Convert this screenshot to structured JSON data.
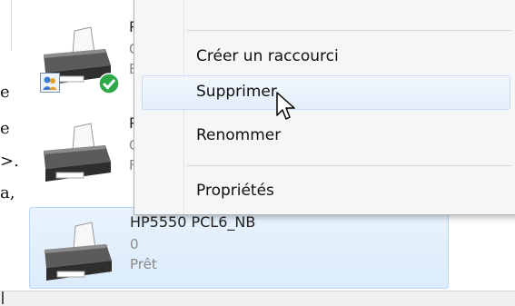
{
  "document_fragments": [
    "e",
    "e",
    ">.",
    "a,"
  ],
  "printers": [
    {
      "name_visible": "P",
      "count_visible": "C",
      "status_visible": "E",
      "shared": true,
      "default": true
    },
    {
      "name_visible": "P",
      "count_visible": "C",
      "status_visible": "F",
      "shared": false,
      "default": false
    },
    {
      "name": "HP5550 PCL6_NB",
      "count": "0",
      "status": "Prêt",
      "selected": true
    }
  ],
  "context_menu": {
    "items": [
      {
        "label": "Créer un raccourci"
      },
      {
        "label": "Supprimer",
        "hovered": true
      },
      {
        "label": "Renommer"
      },
      {
        "label": "Propriétés"
      }
    ]
  },
  "colors": {
    "selection_bg": "#dcecfc",
    "selection_border": "#b8d6f5",
    "menu_bg": "#f5f6f7",
    "default_check": "#2fa84a"
  },
  "icons": [
    "printer-icon",
    "shared-users-icon",
    "default-check-icon",
    "mouse-cursor-icon"
  ]
}
